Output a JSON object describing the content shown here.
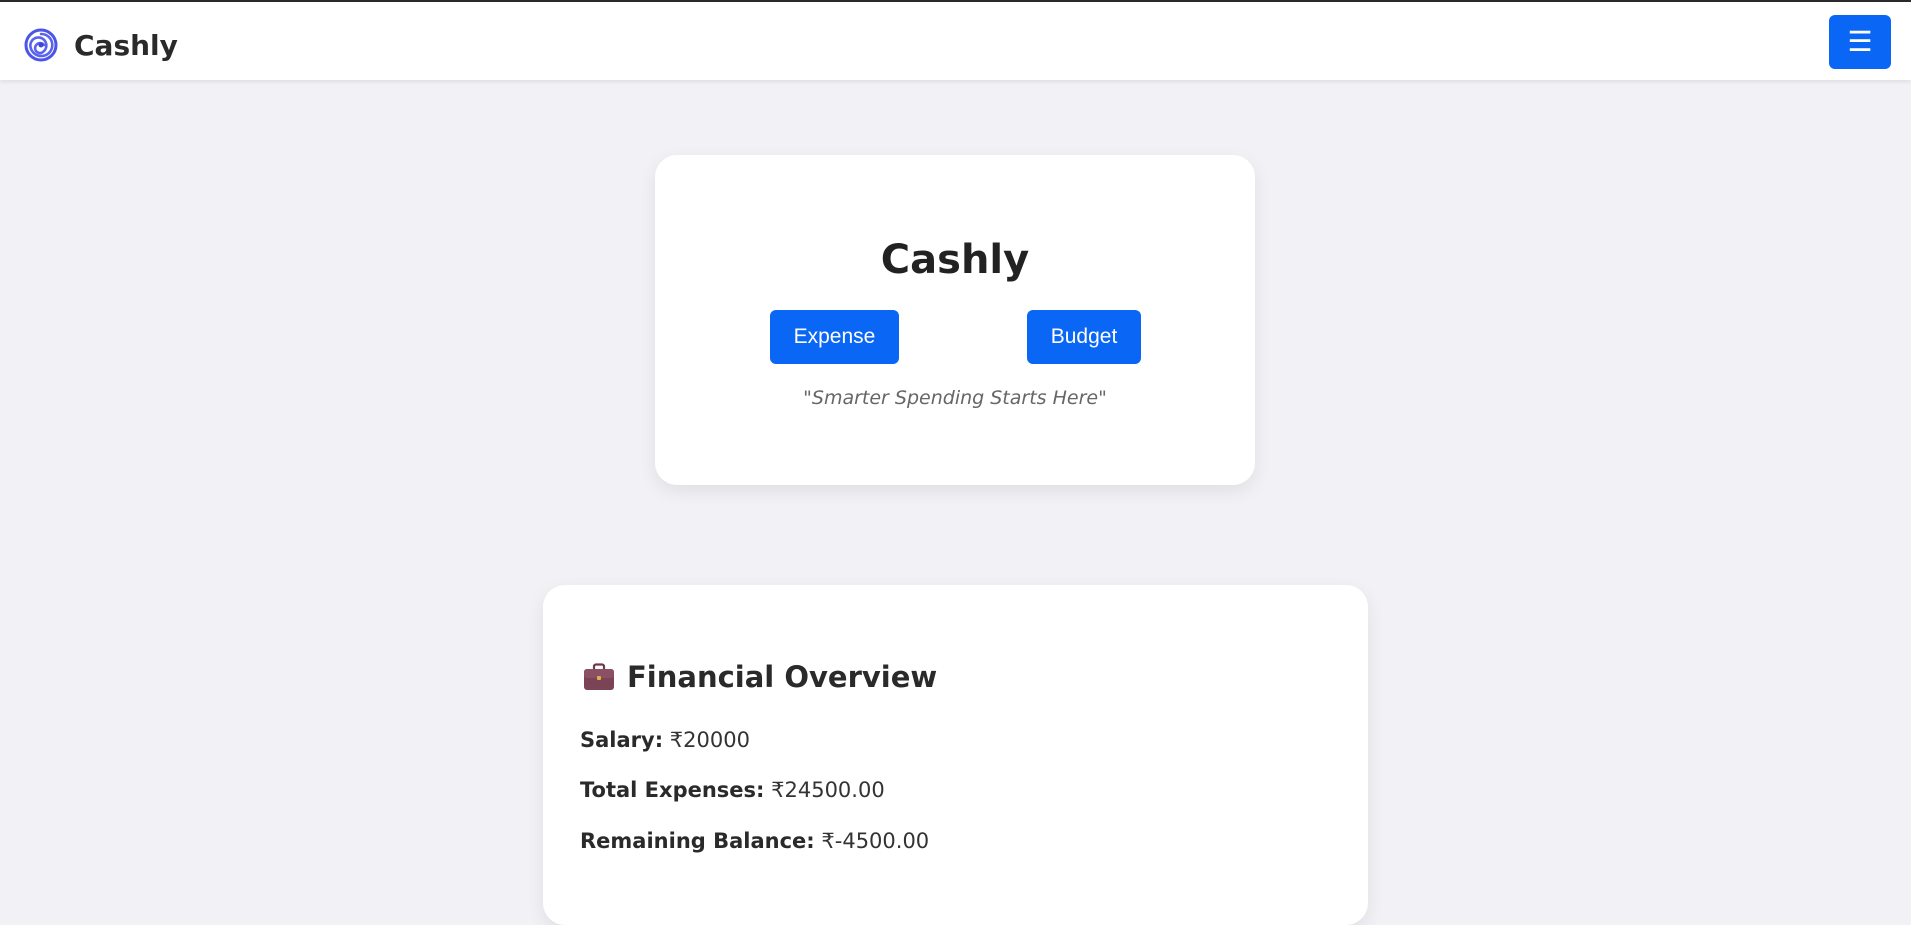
{
  "navbar": {
    "brand_icon": "swirl-logo-icon",
    "brand_name": "Cashly",
    "menu_icon": "☰",
    "accent_color": "#0a66f5"
  },
  "hero": {
    "title": "Cashly",
    "expense_button": "Expense",
    "budget_button": "Budget",
    "tagline": "\"Smarter Spending Starts Here\""
  },
  "overview": {
    "icon": "briefcase-icon",
    "title": "Financial Overview",
    "salary_label": "Salary:",
    "salary_value": "₹20000",
    "expenses_label": "Total Expenses:",
    "expenses_value": "₹24500.00",
    "balance_label": "Remaining Balance:",
    "balance_value": "₹-4500.00"
  }
}
